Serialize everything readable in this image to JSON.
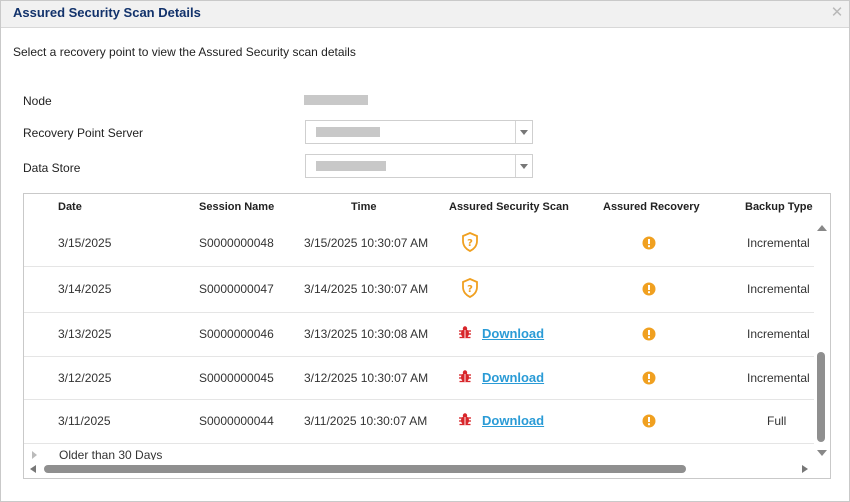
{
  "dialog": {
    "title": "Assured Security Scan Details",
    "close_icon": "close-icon",
    "instruction": "Select a recovery point to view the Assured Security scan details"
  },
  "form": {
    "node_label": "Node",
    "rps_label": "Recovery Point Server",
    "datastore_label": "Data Store"
  },
  "grid": {
    "columns": [
      "Date",
      "Session Name",
      "Time",
      "Assured Security Scan",
      "Assured Recovery",
      "Backup Type"
    ],
    "rows": [
      {
        "date": "3/15/2025",
        "session": "S0000000048",
        "time": "3/15/2025 10:30:07 AM",
        "scan": "shield-question-icon",
        "scan_link": "",
        "recovery": "warning-icon",
        "type": "Incremental"
      },
      {
        "date": "3/14/2025",
        "session": "S0000000047",
        "time": "3/14/2025 10:30:07 AM",
        "scan": "shield-question-icon",
        "scan_link": "",
        "recovery": "warning-icon",
        "type": "Incremental"
      },
      {
        "date": "3/13/2025",
        "session": "S0000000046",
        "time": "3/13/2025 10:30:08 AM",
        "scan": "bug-icon",
        "scan_link": "Download",
        "recovery": "warning-icon",
        "type": "Incremental"
      },
      {
        "date": "3/12/2025",
        "session": "S0000000045",
        "time": "3/12/2025 10:30:07 AM",
        "scan": "bug-icon",
        "scan_link": "Download",
        "recovery": "warning-icon",
        "type": "Incremental"
      },
      {
        "date": "3/11/2025",
        "session": "S0000000044",
        "time": "3/11/2025 10:30:07 AM",
        "scan": "bug-icon",
        "scan_link": "Download",
        "recovery": "warning-icon",
        "type": "Full"
      }
    ],
    "group_label": "Older than 30 Days"
  },
  "colors": {
    "title": "#12326b",
    "link": "#2a9bd6",
    "shield": "#f0a020",
    "bug": "#d8262b",
    "warning": "#f0a020"
  }
}
